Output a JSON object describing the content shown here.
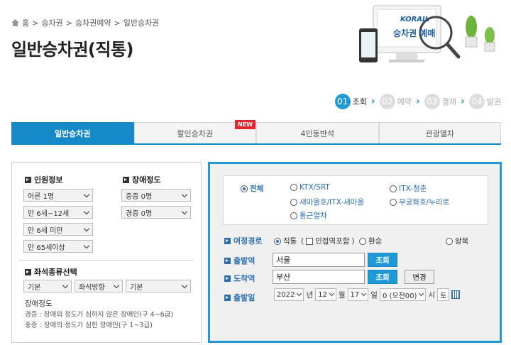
{
  "breadcrumb": [
    "홈",
    "승차권",
    "승차권예약",
    "일반승차권"
  ],
  "page_title": "일반승차권(직통)",
  "hero": {
    "brand": "KORAIL",
    "caption": "승차권 예매"
  },
  "steps": [
    {
      "num": "01",
      "label": "조회",
      "active": true
    },
    {
      "num": "02",
      "label": "예약",
      "active": false
    },
    {
      "num": "03",
      "label": "결제",
      "active": false
    },
    {
      "num": "04",
      "label": "발권",
      "active": false
    }
  ],
  "tabs": [
    {
      "label": "일반승차권",
      "active": true
    },
    {
      "label": "할인승차권",
      "badge": "NEW"
    },
    {
      "label": "4인동반석"
    },
    {
      "label": "관광열차"
    }
  ],
  "left": {
    "people_title": "인원정보",
    "disability_title": "장애정도",
    "people": [
      "어른 1명",
      "만 6세~12세",
      "만 6세 미만",
      "만 65세이상"
    ],
    "disability": [
      "중증 0명",
      "경증 0명"
    ],
    "seat_title": "좌석종류선택",
    "seat_selects": [
      "기본",
      "좌석방향",
      "기본"
    ],
    "note_title": "장애정도",
    "note_lines": [
      "경증 : 장애의 정도가 심하지 않은 장애인(구 4~6급)",
      "중증 : 장애의 정도가 심한 장애인(구 1~3급)"
    ]
  },
  "train_types": {
    "all": "전체",
    "items": [
      "KTX/SRT",
      "ITX-청춘",
      "새마을호/ITX-새마을",
      "무궁화호/누리로",
      "통근열차"
    ]
  },
  "form": {
    "route_label": "여정경로",
    "route_direct": "직통",
    "route_adjacent": "인접역포함",
    "route_transfer": "환승",
    "route_round": "왕복",
    "dep_label": "출발역",
    "dep_value": "서울",
    "arr_label": "도착역",
    "arr_value": "부산",
    "search_btn": "조회",
    "swap_btn": "변경",
    "date_label": "출발일",
    "year": "2022",
    "year_unit": "년",
    "month": "12",
    "month_unit": "월",
    "day": "17",
    "day_unit": "일",
    "hour": "0 (오전00)",
    "hour_unit": "시",
    "weekday": "토"
  },
  "colors": {
    "accent": "#1f9ad6",
    "badge": "#e0262f"
  }
}
